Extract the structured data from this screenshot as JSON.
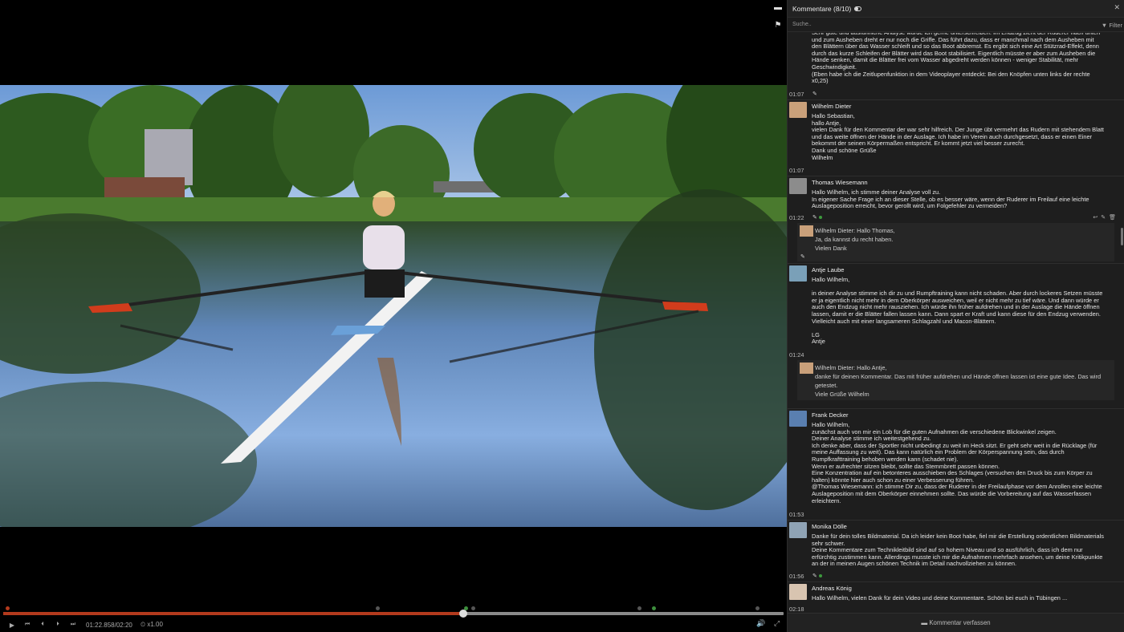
{
  "video": {
    "current_time": "01:22.858",
    "duration": "02:20",
    "playback_speed": "x1.00",
    "progress": 0.59
  },
  "panel": {
    "title": "Kommentare (8/10)",
    "search_placeholder": "Suche..",
    "filter_label": "Filter",
    "compose_label": "Kommentar verfassen"
  },
  "comments": {
    "c0": {
      "body": "Sehr gute und ausführliche Analyse wurde ich gerne unterschreiben. Im Endzug zieht der Ruderer nach unten\nund zum Ausheben dreht er nur noch die Griffe. Das führt dazu, dass er manchmal nach dem Ausheben mit\nden Blättern über das Wasser schleift und so das Boot abbremst. Es ergibt sich eine Art Stützrad-Effekt, denn\ndurch das kurze Schleifen der Blätter wird das Boot stabilisiert. Eigentlich müsste er aber zum Ausheben die\nHände senken, damit die Blätter frei vom Wasser abgedreht werden können - weniger Stabilität, mehr\nGeschwindigkeit.\n(Eben habe ich die Zeitlupenfunktion in dem Videoplayer entdeckt: Bei den Knöpfen unten links der rechte\nx0,25)",
      "time": "01:07"
    },
    "c1": {
      "name": "Wilhelm Dieter",
      "body": "Hallo Sebastian,\nhallo Antje,\nvielen Dank für den Kommentar der war sehr hilfreich. Der Junge übt vermehrt das Rudern mit stehendem Blatt\nund das weite öffnen der Hände in der Auslage. Ich habe im Verein auch durchgesetzt, dass er einen Einer\nbekommt der seinen Körpermaßen entspricht. Er kommt jetzt viel besser zurecht.\nDank und schöne Grüße\nWilhelm",
      "time": "01:07"
    },
    "c2": {
      "name": "Thomas Wiesemann",
      "body": "Hallo Wilhelm, ich stimme deiner Analyse voll zu.\nIn eigener Sache Frage ich an dieser Stelle, ob es besser wäre, wenn der Ruderer im Freilauf eine leichte\nAuslageposition erreicht, bevor gerollt wird, um Folgefehler zu vermeiden?",
      "time": "01:22",
      "reply": "Wilhelm Dieter: Hallo Thomas,\nJa, da kannst du recht haben.\nVielen Dank"
    },
    "c3": {
      "name": "Antje Laube",
      "body": "Hallo Wilhelm,\n\nin deiner Analyse stimme ich dir zu und Rumpftraining kann nicht schaden. Aber durch lockeres Setzen müsste\ner ja eigentlich nicht mehr in dem Oberkörper ausweichen, weil er nicht mehr zu tief wäre. Und dann würde er\nauch den Endzug nicht mehr rausziehen. Ich würde ihn früher aufdrehen und in der Auslage die Hände öffnen\nlassen, damit er die Blätter fallen lassen kann. Dann spart er Kraft und kann diese für den Endzug verwenden.\nVielleicht auch mit einer langsameren Schlagzahl und Macon-Blättern.\n\nLG\nAntje",
      "time": "01:24",
      "reply": "Wilhelm Dieter: Hallo Antje,\ndanke für deinen Kommentar. Das mit früher aufdrehen und Hände offnen lassen ist eine gute Idee. Das wird\ngetestet.\nViele Grüße Wilhelm"
    },
    "c4": {
      "name": "Frank Decker",
      "body": "Hallo Wilhelm,\nzunächst auch von mir ein Lob für die guten Aufnahmen die verschiedene Blickwinkel zeigen.\nDeiner Analyse stimme ich weitestgehend zu.\nIch denke aber, dass der Sportler nicht unbedingt zu weit im Heck sitzt. Er geht sehr weit in die Rücklage (für\nmeine Auffassung zu weit). Das kann natürlich ein Problem der Körperspannung sein, das durch\nRumpfkrafttraining behoben werden kann (schadet nie).\nWenn er aufrechter sitzen bleibt, sollte das Stemmbrett passen können.\nEine Konzentration auf ein betonteres ausschieben des Schlages (versuchen den Druck bis zum Körper zu\nhalten) könnte hier auch schon zu einer Verbesserung führen.\n@Thomas Wiesemann: ich stimme Dir zu, dass der Ruderer in der Freilaufphase vor dem Anrollen eine leichte\nAuslageposition mit dem Oberkörper einnehmen sollte. Das würde die Vorbereitung auf das Wasserfassen\nerleichtern.",
      "time": "01:53"
    },
    "c5": {
      "name": "Monika Dölle",
      "body": "Danke für dein tolles Bildmaterial. Da ich leider kein Boot habe, fiel mir die Erstellung ordentlichen Bildmaterials\nsehr schwer.\nDeine Kommentare zum Technikleitbild sind auf so hohem Niveau und so ausführlich, dass ich dem nur\nerfürchtig zustimmen kann. Allerdings musste ich mir die Aufnahmen mehrfach ansehen, um deine Kritikpunkte\nan der in meinen Augen schönen Technik im Detail nachvollziehen zu können.",
      "time": "01:56"
    },
    "c6": {
      "name": "Andreas König",
      "body": "Hallo Wilhelm, vielen Dank für dein Video und deine Kommentare. Schön bei euch in Tübingen ...",
      "time": "02:18"
    }
  },
  "colors": {
    "accent_progress": "#b33a1d",
    "marker_green": "#3d8f3d",
    "panel_bg": "#1e1e1e"
  },
  "icons": {
    "side": [
      "comment-icon",
      "flag-icon"
    ],
    "controls": [
      "play-icon",
      "skip-back-icon",
      "step-back-icon",
      "step-forward-icon",
      "skip-forward-icon",
      "speed-icon",
      "volume-icon",
      "fullscreen-icon"
    ],
    "comment_actions": [
      "reply-icon",
      "edit-icon",
      "delete-icon"
    ]
  }
}
